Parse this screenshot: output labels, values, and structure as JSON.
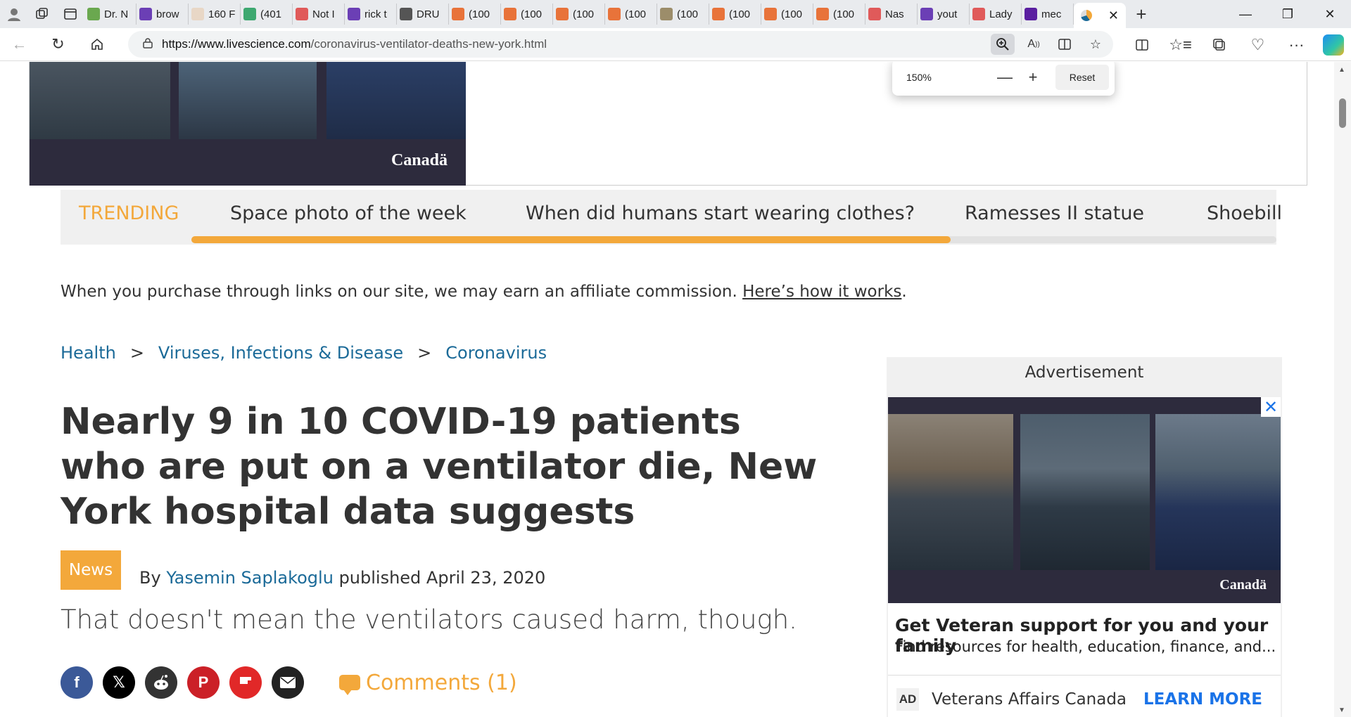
{
  "browser": {
    "tabs": [
      {
        "label": "Dr. N",
        "fav_color": "#6aa84f"
      },
      {
        "label": "brow",
        "fav_color": "#6b3fb5"
      },
      {
        "label": "160 F",
        "fav_color": "#e8d7c6"
      },
      {
        "label": "(401",
        "fav_color": "#3ea870"
      },
      {
        "label": "Not I",
        "fav_color": "#e05a5a"
      },
      {
        "label": "rick t",
        "fav_color": "#6b3fb5"
      },
      {
        "label": "DRU",
        "fav_color": "#555555"
      },
      {
        "label": "(100",
        "fav_color": "#e8733a"
      },
      {
        "label": "(100",
        "fav_color": "#e8733a"
      },
      {
        "label": "(100",
        "fav_color": "#e8733a"
      },
      {
        "label": "(100",
        "fav_color": "#e8733a"
      },
      {
        "label": "(100",
        "fav_color": "#9c8d6a"
      },
      {
        "label": "(100",
        "fav_color": "#e8733a"
      },
      {
        "label": "(100",
        "fav_color": "#e8733a"
      },
      {
        "label": "(100",
        "fav_color": "#e8733a"
      },
      {
        "label": "Nas",
        "fav_color": "#e05a5a"
      },
      {
        "label": "yout",
        "fav_color": "#6b3fb5"
      },
      {
        "label": "Lady",
        "fav_color": "#e05a5a"
      },
      {
        "label": "mec",
        "fav_color": "#5a1fa0"
      }
    ],
    "url_host": "https://www.livescience.com",
    "url_path": "/coronavirus-ventilator-deaths-new-york.html",
    "zoom": {
      "value": "150%",
      "reset_label": "Reset"
    }
  },
  "top_ad": {
    "brand": "Canadä"
  },
  "trending": {
    "label": "TRENDING",
    "items": [
      "Space photo of the week",
      "When did humans start wearing clothes?",
      "Ramesses II statue",
      "Shoebill"
    ],
    "progress": 0.7
  },
  "affiliate": {
    "text": "When you purchase through links on our site, we may earn an affiliate commission.",
    "link": "Here’s how it works",
    "end": "."
  },
  "breadcrumbs": [
    "Health",
    ">",
    "Viruses, Infections & Disease",
    ">",
    "Coronavirus"
  ],
  "article": {
    "title": "Nearly 9 in 10 COVID-19 patients who are put on a ventilator die, New York hospital data suggests",
    "badge": "News",
    "by": "By",
    "author": "Yasemin Saplakoglu",
    "published": "published April 23, 2020",
    "strapline": "That doesn't mean the ventilators caused harm, though.",
    "comments": "Comments (1)"
  },
  "share": [
    {
      "name": "facebook",
      "glyph": "f",
      "color": "#3b5998"
    },
    {
      "name": "x",
      "glyph": "𝕏",
      "color": "#000000"
    },
    {
      "name": "reddit",
      "glyph": "●",
      "color": "#333333"
    },
    {
      "name": "pinterest",
      "glyph": "P",
      "color": "#cb2027"
    },
    {
      "name": "flipboard",
      "glyph": "F",
      "color": "#e12828"
    },
    {
      "name": "email",
      "glyph": "✉",
      "color": "#222222"
    }
  ],
  "side_ad": {
    "label": "Advertisement",
    "brand": "Canadä",
    "title": "Get Veteran support for you and your family",
    "text": "Find resources for health, education, finance, and...",
    "tag": "AD",
    "advertiser": "Veterans Affairs Canada",
    "cta": "LEARN MORE"
  }
}
